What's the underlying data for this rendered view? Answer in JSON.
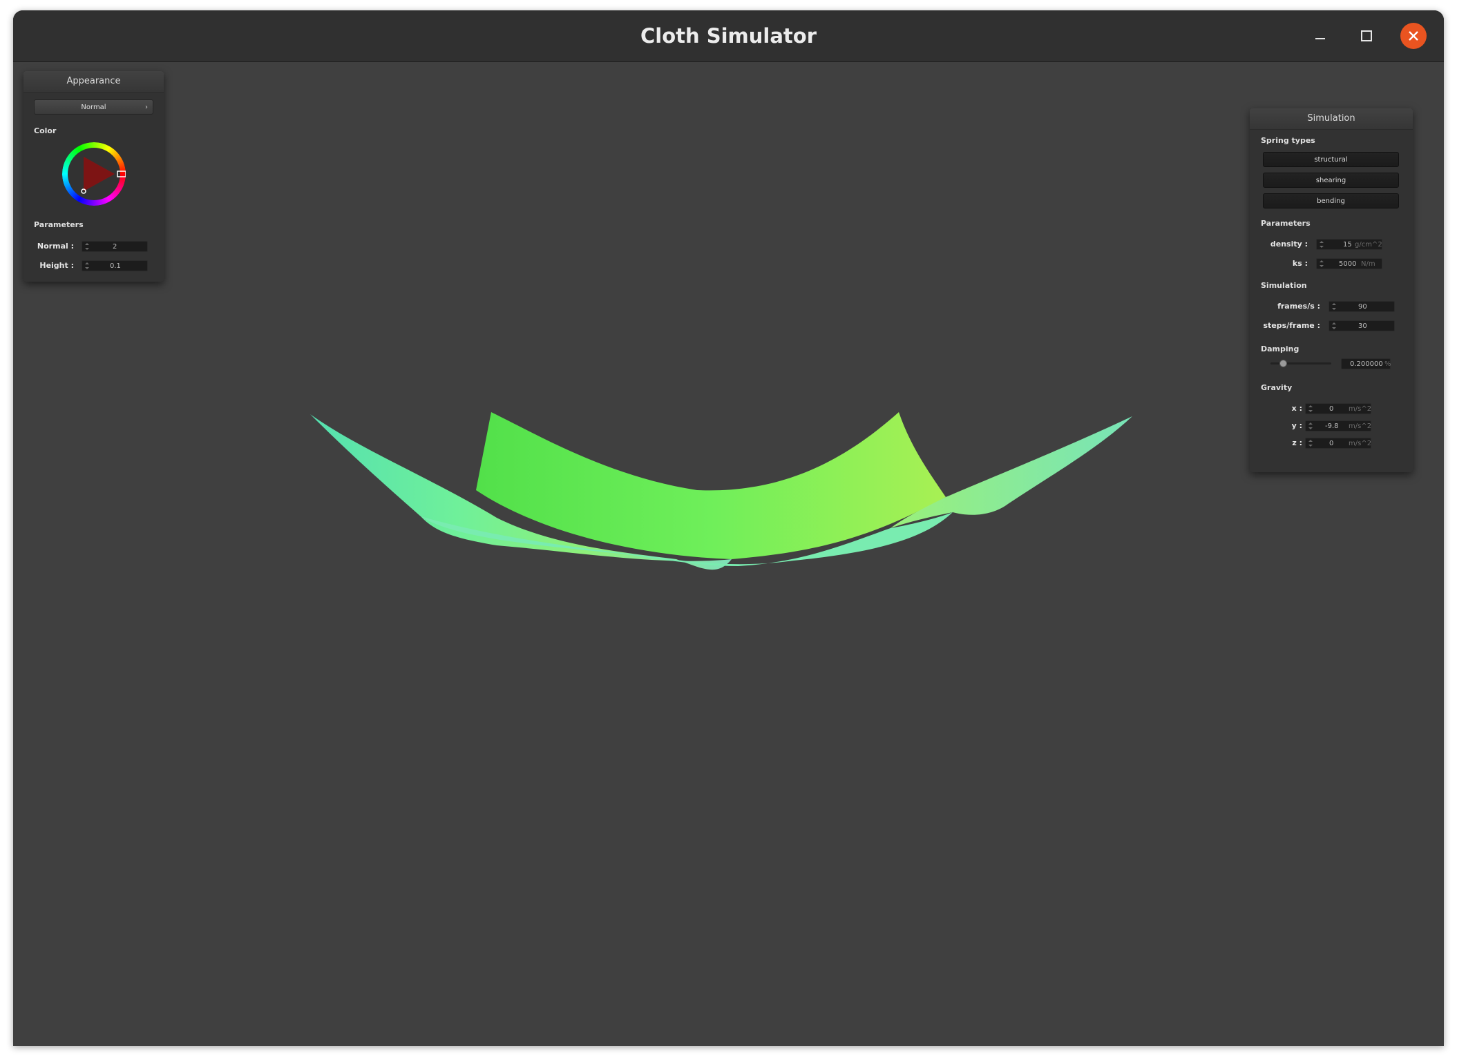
{
  "window": {
    "title": "Cloth Simulator"
  },
  "appearance": {
    "title": "Appearance",
    "mode": "Normal",
    "color_label": "Color",
    "color_value": "#ff0000",
    "params_label": "Parameters",
    "normal_label": "Normal :",
    "normal_value": "2",
    "height_label": "Height :",
    "height_value": "0.1"
  },
  "simulation": {
    "title": "Simulation",
    "spring_types_label": "Spring types",
    "spring_types": [
      "structural",
      "shearing",
      "bending"
    ],
    "params_label": "Parameters",
    "density_label": "density :",
    "density_value": "15",
    "density_unit": "g/cm^2",
    "ks_label": "ks :",
    "ks_value": "5000",
    "ks_unit": "N/m",
    "sim_label": "Simulation",
    "fps_label": "frames/s :",
    "fps_value": "90",
    "steps_label": "steps/frame :",
    "steps_value": "30",
    "damping_label": "Damping",
    "damping_value": "0.200000",
    "damping_unit": "%",
    "damping_fraction": 0.2,
    "gravity_label": "Gravity",
    "gx_label": "x :",
    "gx_value": "0",
    "gy_label": "y :",
    "gy_value": "-9.8",
    "gz_label": "z :",
    "gz_value": "0",
    "gravity_unit": "m/s^2"
  }
}
